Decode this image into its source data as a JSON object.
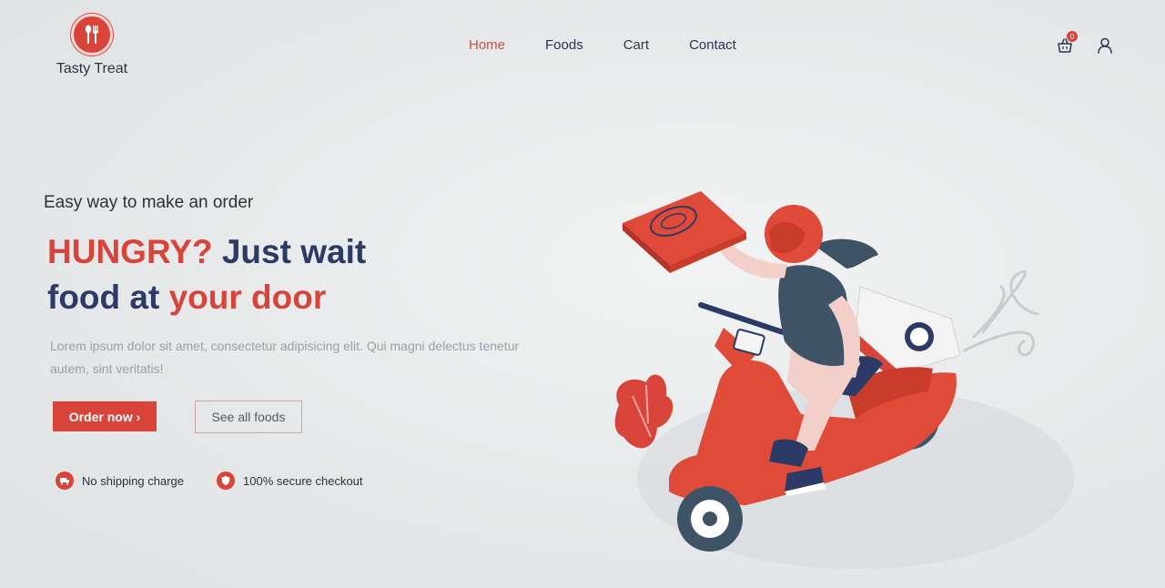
{
  "brand": {
    "name": "Tasty Treat"
  },
  "nav": {
    "items": [
      {
        "label": "Home",
        "active": true
      },
      {
        "label": "Foods",
        "active": false
      },
      {
        "label": "Cart",
        "active": false
      },
      {
        "label": "Contact",
        "active": false
      }
    ]
  },
  "header": {
    "cart_count": "0"
  },
  "hero": {
    "tagline": "Easy way to make an order",
    "headline_part1": "HUNGRY?",
    "headline_part2": " Just wait",
    "headline_part3": "food at ",
    "headline_part4": "your door",
    "description": "Lorem ipsum dolor sit amet, consectetur adipisicing elit. Qui magni delectus tenetur autem, sint veritatis!",
    "order_button": "Order now ›",
    "see_all_button": "See all foods"
  },
  "features": [
    {
      "icon": "truck-icon",
      "label": "No shipping charge"
    },
    {
      "icon": "shield-icon",
      "label": "100% secure checkout"
    }
  ],
  "colors": {
    "accent": "#d8443a",
    "navy": "#2c3a66"
  }
}
